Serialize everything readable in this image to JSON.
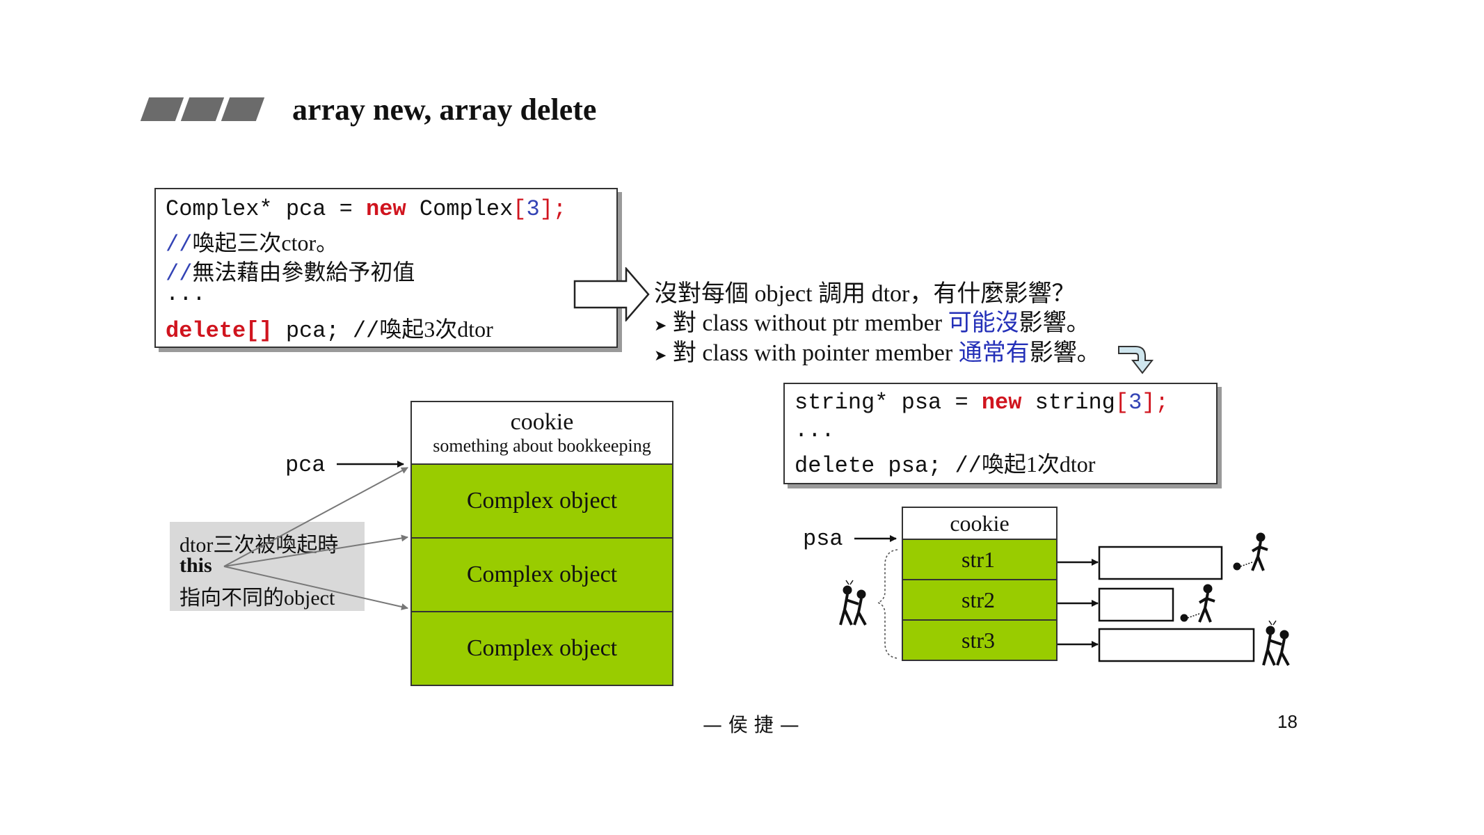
{
  "slide": {
    "title": "array new, array delete",
    "footer": "— 侯 捷 —",
    "page_number": "18"
  },
  "code1": {
    "line1_a": "Complex* pca = ",
    "line1_kw": "new",
    "line1_b": " Complex",
    "line1_open": "[",
    "line1_num": "3",
    "line1_close": "];",
    "line2_slash": "//",
    "line2_text": "喚起三次ctor。",
    "line3_slash": "//",
    "line3_text": "無法藉由參數給予初值",
    "line4": "...",
    "line5_kw": "delete[]",
    "line5_b": " pca;  //",
    "line5_text": "喚起3次dtor"
  },
  "question": {
    "heading": "沒對每個 object 調用 dtor，有什麼影響？",
    "bullet1_a": "對 class without ptr member ",
    "bullet1_blue": "可能沒",
    "bullet1_b": "影響。",
    "bullet2_a": "對 class with pointer member ",
    "bullet2_blue": "通常有",
    "bullet2_b": "影響。"
  },
  "code2": {
    "line1_a": "string* psa = ",
    "line1_kw": "new",
    "line1_b": " string",
    "line1_open": "[",
    "line1_num": "3",
    "line1_close": "];",
    "line2": "...",
    "line3_a": "delete psa;  //",
    "line3_text": "喚起1次dtor"
  },
  "left_diagram": {
    "pointer_label": "pca",
    "cookie_title": "cookie",
    "cookie_sub": "something about bookkeeping",
    "cells": [
      "Complex object",
      "Complex object",
      "Complex object"
    ],
    "note_line1": "dtor三次被喚起時",
    "note_line2": "this",
    "note_line3": "指向不同的object"
  },
  "right_diagram": {
    "pointer_label": "psa",
    "cookie_title": "cookie",
    "cells": [
      "str1",
      "str2",
      "str3"
    ]
  },
  "colors": {
    "green": "#99cc00",
    "keyword_red": "#d0141e",
    "comment_blue": "#3343b5",
    "highlight_blue": "#2430b8",
    "note_gray": "#d9d9d9"
  }
}
